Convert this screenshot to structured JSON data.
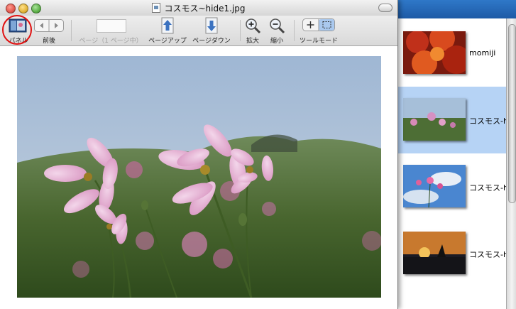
{
  "window": {
    "title": "コスモス~hide1.jpg"
  },
  "toolbar": {
    "panel_label": "パネル",
    "prevnext_label": "前後",
    "page_label": "ページ（1 ページ中）",
    "page_input_value": "",
    "page_up_label": "ページアップ",
    "page_down_label": "ページダウン",
    "zoom_in_label": "拡大",
    "zoom_out_label": "縮小",
    "tool_mode_label": "ツールモード"
  },
  "sidebar": {
    "items": [
      {
        "label": "momiji",
        "selected": false
      },
      {
        "label": "コスモス-hi",
        "selected": true
      },
      {
        "label": "コスモス-hi",
        "selected": false
      },
      {
        "label": "コスモス-hi",
        "selected": false
      }
    ]
  },
  "colors": {
    "selection": "#b6d3f5",
    "highlight_circle": "#e01010",
    "close": "#e35a50",
    "minimize": "#e2b53a",
    "zoom": "#5fb14a"
  }
}
